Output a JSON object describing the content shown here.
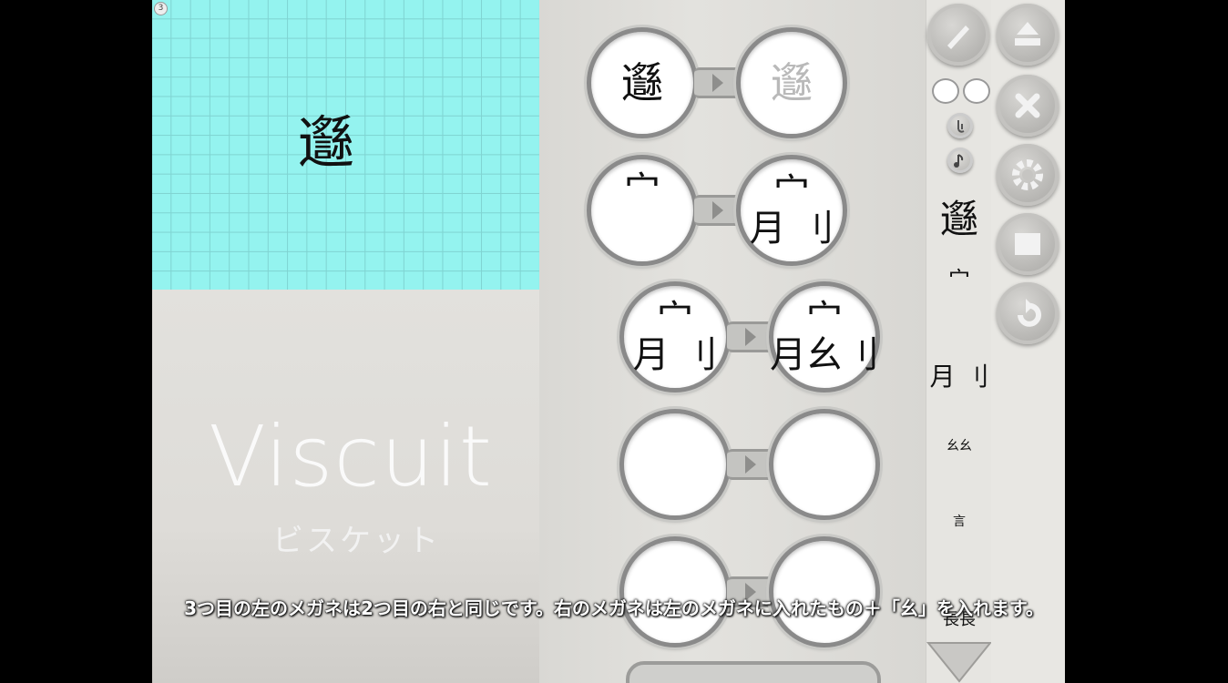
{
  "stage": {
    "number": "3",
    "sprite": "邎"
  },
  "logo": {
    "title": "Viscuit",
    "subtitle": "ビスケット"
  },
  "glasses": [
    {
      "left": "邎",
      "right": "邎",
      "right_ghost": true
    },
    {
      "left": "宀",
      "right": "宀\n月 刂"
    },
    {
      "left": "宀\n月 刂",
      "right": "宀\n月幺刂"
    },
    {
      "left": "",
      "right": ""
    },
    {
      "left": "",
      "right": ""
    }
  ],
  "palette": {
    "items": [
      "邎",
      "宀",
      "月 刂",
      "幺幺",
      "言",
      "長長"
    ]
  },
  "tools": {
    "pencil": "pencil-icon",
    "upload": "upload-icon",
    "delete": "close-icon",
    "settings": "gear-icon",
    "blank": "blank-card-icon",
    "undo": "undo-icon"
  },
  "caption": "3つ目の左のメガネは2つ目の右と同じです。右のメガネは左のメガネに入れたもの＋「幺」を入れます。"
}
